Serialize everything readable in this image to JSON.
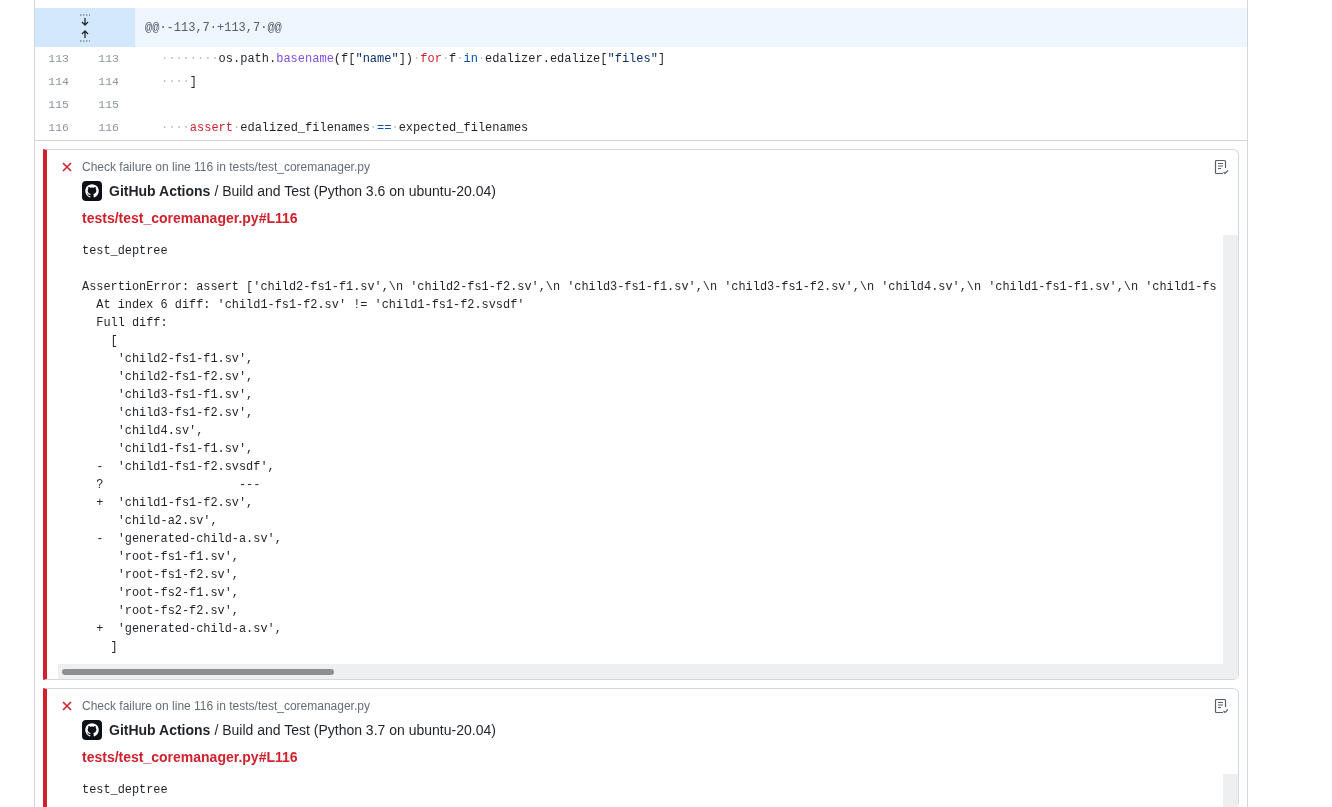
{
  "diff": {
    "hunk": {
      "header": "@@·-113,7·+113,7·@@"
    },
    "lines": [
      {
        "old": "113",
        "new": "113",
        "tokens": [
          {
            "kind": "ws",
            "text": "········"
          },
          {
            "kind": "plain",
            "text": "os.path."
          },
          {
            "kind": "func",
            "text": "basename"
          },
          {
            "kind": "plain",
            "text": "(f["
          },
          {
            "kind": "string",
            "text": "\"name\""
          },
          {
            "kind": "plain",
            "text": "])"
          },
          {
            "kind": "ws",
            "text": "·"
          },
          {
            "kind": "keyword",
            "text": "for"
          },
          {
            "kind": "ws",
            "text": "·"
          },
          {
            "kind": "plain",
            "text": "f"
          },
          {
            "kind": "ws",
            "text": "·"
          },
          {
            "kind": "op",
            "text": "in"
          },
          {
            "kind": "ws",
            "text": "·"
          },
          {
            "kind": "plain",
            "text": "edalizer.edalize["
          },
          {
            "kind": "string",
            "text": "\"files\""
          },
          {
            "kind": "plain",
            "text": "]"
          }
        ]
      },
      {
        "old": "114",
        "new": "114",
        "tokens": [
          {
            "kind": "ws",
            "text": "····"
          },
          {
            "kind": "plain",
            "text": "]"
          }
        ]
      },
      {
        "old": "115",
        "new": "115"
      },
      {
        "old": "116",
        "new": "116",
        "tokens": [
          {
            "kind": "ws",
            "text": "····"
          },
          {
            "kind": "keyword",
            "text": "assert"
          },
          {
            "kind": "ws",
            "text": "·"
          },
          {
            "kind": "plain",
            "text": "edalized_filenames"
          },
          {
            "kind": "ws",
            "text": "·"
          },
          {
            "kind": "op",
            "text": "=="
          },
          {
            "kind": "ws",
            "text": "·"
          },
          {
            "kind": "plain",
            "text": "expected_filenames"
          }
        ]
      }
    ]
  },
  "annotations": [
    {
      "title": "Check failure on line 116 in tests/test_coremanager.py",
      "app": "GitHub Actions",
      "job": "/ Build and Test (Python 3.6 on ubuntu-20.04)",
      "link": "tests/test_coremanager.py#L116",
      "log": [
        {
          "lines": [
            "test_deptree"
          ]
        },
        {
          "lines": [
            "AssertionError: assert ['child2-fs1-f1.sv',\\n 'child2-fs1-f2.sv',\\n 'child3-fs1-f1.sv',\\n 'child3-fs1-f2.sv',\\n 'child4.sv',\\n 'child1-fs1-f1.sv',\\n 'child1-fs",
            "  At index 6 diff: 'child1-fs1-f2.sv' != 'child1-fs1-f2.svsdf'",
            "  Full diff:",
            "    [",
            "     'child2-fs1-f1.sv',",
            "     'child2-fs1-f2.sv',",
            "     'child3-fs1-f1.sv',",
            "     'child3-fs1-f2.sv',",
            "     'child4.sv',",
            "     'child1-fs1-f1.sv',",
            "  -  'child1-fs1-f2.svsdf',",
            "  ?                   ---",
            "  +  'child1-fs1-f2.sv',",
            "     'child-a2.sv',",
            "  -  'generated-child-a.sv',",
            "     'root-fs1-f1.sv',",
            "     'root-fs1-f2.sv',",
            "     'root-fs2-f1.sv',",
            "     'root-fs2-f2.sv',",
            "  +  'generated-child-a.sv',",
            "    ]"
          ]
        }
      ]
    },
    {
      "title": "Check failure on line 116 in tests/test_coremanager.py",
      "app": "GitHub Actions",
      "job": "/ Build and Test (Python 3.7 on ubuntu-20.04)",
      "link": "tests/test_coremanager.py#L116",
      "log": [
        {
          "lines": [
            "test_deptree"
          ]
        }
      ]
    }
  ]
}
